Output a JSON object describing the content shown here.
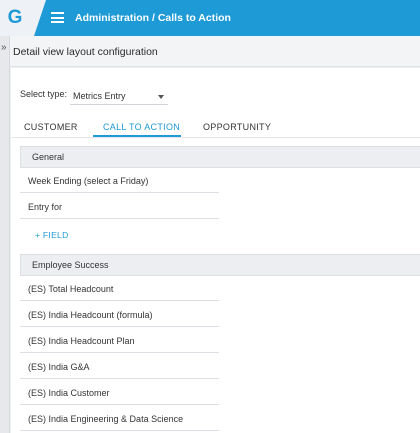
{
  "header": {
    "logo_letter": "G",
    "breadcrumb": "Administration / Calls to Action"
  },
  "page": {
    "title": "Detail view layout configuration",
    "expander_glyph": "»"
  },
  "type_select": {
    "label": "Select type:",
    "value": "Metrics Entry"
  },
  "tabs": [
    {
      "label": "CUSTOMER",
      "active": false
    },
    {
      "label": "CALL TO ACTION",
      "active": true
    },
    {
      "label": "OPPORTUNITY",
      "active": false
    }
  ],
  "sections": [
    {
      "title": "General",
      "fields": [
        "Week Ending (select a Friday)",
        "Entry for"
      ],
      "add_field_label": "+ FIELD"
    },
    {
      "title": "Employee Success",
      "fields": [
        "(ES) Total Headcount",
        "(ES) India Headcount (formula)",
        "(ES) India Headcount Plan",
        "(ES) India G&A",
        "(ES) India Customer",
        "(ES) India Engineering & Data Science"
      ]
    }
  ],
  "colors": {
    "accent": "#1e9ad6",
    "topbar": "#1e9ad6"
  }
}
